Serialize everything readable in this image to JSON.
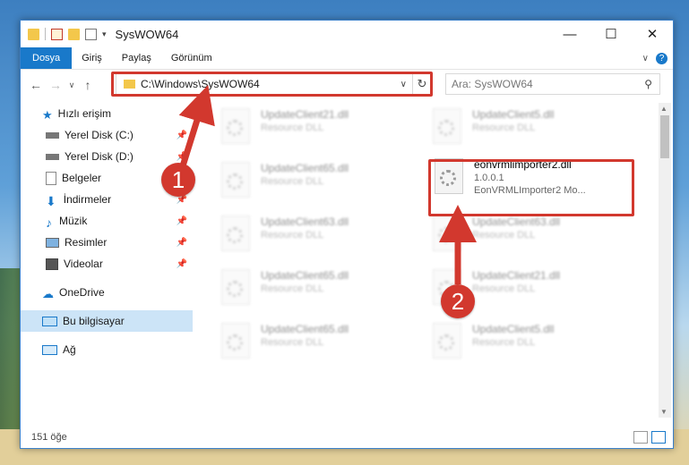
{
  "window": {
    "title": "SysWOW64"
  },
  "controls": {
    "minimize": "—",
    "maximize": "☐",
    "close": "✕"
  },
  "ribbon": {
    "tabs": [
      "Dosya",
      "Giriş",
      "Paylaş",
      "Görünüm"
    ],
    "expand": "∨",
    "help": "?"
  },
  "nav": {
    "back": "←",
    "forward": "→",
    "recent": "∨",
    "up": "↑"
  },
  "address": {
    "path": "C:\\Windows\\SysWOW64",
    "dropdown": "∨",
    "refresh": "↻"
  },
  "search": {
    "placeholder": "Ara: SysWOW64",
    "icon": "⚲"
  },
  "sidebar": {
    "items": [
      {
        "label": "Hızlı erişim",
        "icon": "star-icon",
        "pinned": false
      },
      {
        "label": "Yerel Disk (C:)",
        "icon": "drive-icon",
        "pinned": true
      },
      {
        "label": "Yerel Disk (D:)",
        "icon": "drive-icon",
        "pinned": true
      },
      {
        "label": "Belgeler",
        "icon": "document-icon",
        "pinned": true
      },
      {
        "label": "İndirmeler",
        "icon": "download-icon",
        "pinned": true
      },
      {
        "label": "Müzik",
        "icon": "music-icon",
        "pinned": true
      },
      {
        "label": "Resimler",
        "icon": "pictures-icon",
        "pinned": true
      },
      {
        "label": "Videolar",
        "icon": "videos-icon",
        "pinned": true
      },
      {
        "label": "OneDrive",
        "icon": "cloud-icon",
        "pinned": false
      },
      {
        "label": "Bu bilgisayar",
        "icon": "computer-icon",
        "pinned": false
      },
      {
        "label": "Ağ",
        "icon": "network-icon",
        "pinned": false
      }
    ],
    "pin_glyph": "📌"
  },
  "files": {
    "left": [
      {
        "name": "UpdateClient21.dll",
        "type": "Resource DLL"
      },
      {
        "name": "UpdateClient65.dll",
        "type": "Resource DLL"
      },
      {
        "name": "UpdateClient63.dll",
        "type": "Resource DLL"
      },
      {
        "name": "UpdateClient65.dll",
        "type": "Resource DLL"
      },
      {
        "name": "UpdateClient65.dll",
        "type": "Resource DLL"
      }
    ],
    "right": [
      {
        "name": "UpdateClient5.dll",
        "type": "Resource DLL"
      },
      {
        "name": "eonvrmlimporter2.dll",
        "version": "1.0.0.1",
        "desc": "EonVRMLImporter2 Mo..."
      },
      {
        "name": "UpdateClient63.dll",
        "type": "Resource DLL"
      },
      {
        "name": "UpdateClient21.dll",
        "type": "Resource DLL"
      },
      {
        "name": "UpdateClient5.dll",
        "type": "Resource DLL"
      }
    ]
  },
  "status": {
    "count": "151 öğe"
  },
  "callouts": {
    "one": "1",
    "two": "2"
  },
  "colors": {
    "accent": "#1979ca",
    "highlight": "#d2382e"
  }
}
